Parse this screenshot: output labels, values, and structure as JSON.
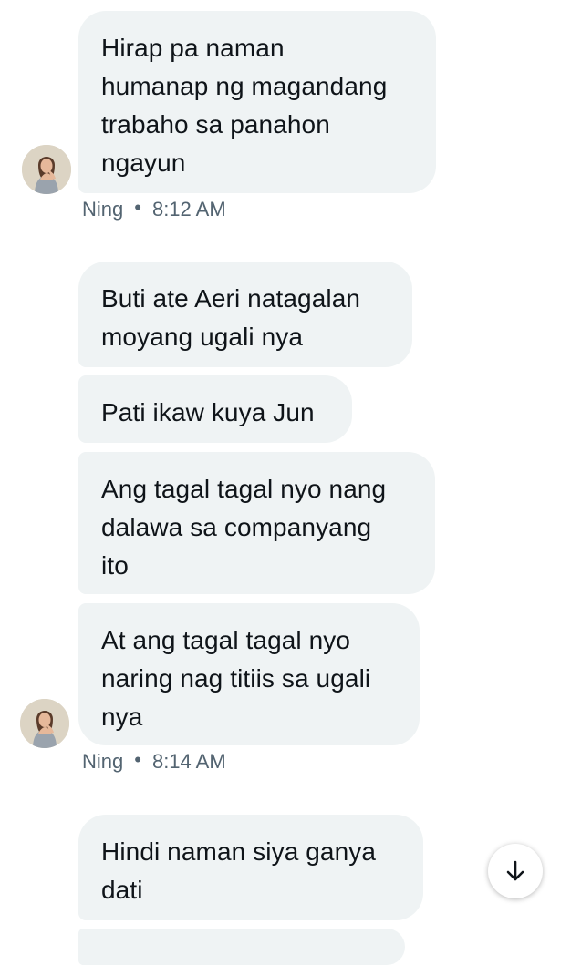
{
  "messages": [
    {
      "lines": [
        "Hirap pa naman",
        "humanap ng magandang",
        "trabaho sa panahon",
        "ngayun"
      ]
    },
    {
      "lines": [
        "Buti ate Aeri natagalan",
        "moyang ugali nya"
      ]
    },
    {
      "lines": [
        "Pati ikaw kuya Jun"
      ]
    },
    {
      "lines": [
        "Ang tagal tagal nyo nang",
        "dalawa sa companyang",
        "ito"
      ]
    },
    {
      "lines": [
        "At ang tagal tagal nyo",
        "naring nag titiis sa ugali",
        "nya"
      ]
    },
    {
      "lines": [
        "Hindi naman siya ganya",
        "dati"
      ]
    }
  ],
  "groups": [
    {
      "sender": "Ning",
      "separator": "•",
      "time": "8:12 AM"
    },
    {
      "sender": "Ning",
      "separator": "•",
      "time": "8:14 AM"
    }
  ],
  "icons": {
    "avatar": "profile-photo",
    "scroll_down": "arrow-down-icon"
  },
  "colors": {
    "bubble": "#eff3f4",
    "text": "#0f1419",
    "meta": "#536471"
  }
}
